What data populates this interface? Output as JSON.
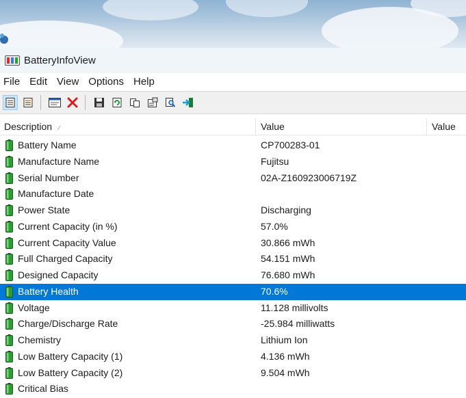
{
  "window": {
    "title": "BatteryInfoView"
  },
  "menu": [
    "File",
    "Edit",
    "View",
    "Options",
    "Help"
  ],
  "columns": {
    "description": "Description",
    "value": "Value",
    "value2": "Value"
  },
  "rows": [
    {
      "description": "Battery Name",
      "value": "CP700283-01"
    },
    {
      "description": "Manufacture Name",
      "value": "Fujitsu"
    },
    {
      "description": "Serial Number",
      "value": "02A-Z160923006719Z"
    },
    {
      "description": "Manufacture Date",
      "value": ""
    },
    {
      "description": "Power State",
      "value": "Discharging"
    },
    {
      "description": "Current Capacity (in %)",
      "value": "57.0%"
    },
    {
      "description": "Current Capacity Value",
      "value": "30.866 mWh"
    },
    {
      "description": "Full Charged Capacity",
      "value": "54.151 mWh"
    },
    {
      "description": "Designed Capacity",
      "value": "76.680 mWh"
    },
    {
      "description": "Battery Health",
      "value": "70.6%",
      "selected": true
    },
    {
      "description": "Voltage",
      "value": "11.128 millivolts"
    },
    {
      "description": "Charge/Discharge Rate",
      "value": "-25.984 milliwatts"
    },
    {
      "description": "Chemistry",
      "value": "Lithium Ion"
    },
    {
      "description": "Low Battery Capacity (1)",
      "value": "4.136 mWh"
    },
    {
      "description": "Low Battery Capacity (2)",
      "value": "9.504 mWh"
    },
    {
      "description": "Critical Bias",
      "value": ""
    }
  ],
  "colors": {
    "selection": "#0078d7",
    "battery_icon": "#2e9b34"
  }
}
